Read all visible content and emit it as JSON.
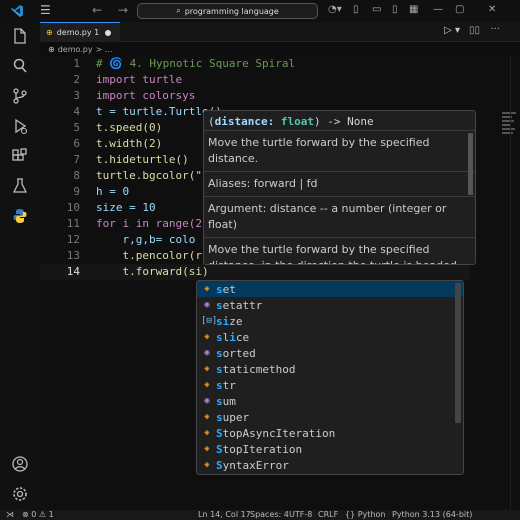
{
  "titlebar": {
    "menu_icon": "hamburger-icon",
    "search_text": "programming language",
    "search_icon": "search-icon"
  },
  "activity": [
    "explorer-icon",
    "search-icon",
    "source-control-icon",
    "run-debug-icon",
    "extensions-icon",
    "testing-icon",
    "python-icon",
    "account-icon",
    "settings-icon"
  ],
  "tab": {
    "label": "demo.py 1"
  },
  "breadcrumb": {
    "file": "demo.py",
    "more": "> ..."
  },
  "editor": {
    "lines": [
      {
        "n": "1",
        "code": "# 🌀 4. Hypnotic Square Spiral"
      },
      {
        "n": "2",
        "code": "import turtle"
      },
      {
        "n": "3",
        "code": "import colorsys"
      },
      {
        "n": "4",
        "code": "t = turtle.Turtle()"
      },
      {
        "n": "5",
        "code": "t.speed(0)"
      },
      {
        "n": "6",
        "code": "t.width(2)"
      },
      {
        "n": "7",
        "code": "t.hideturtle()"
      },
      {
        "n": "8",
        "code": "turtle.bgcolor(\""
      },
      {
        "n": "9",
        "code": "h = 0"
      },
      {
        "n": "10",
        "code": "size = 10"
      },
      {
        "n": "11",
        "code": "for i in range(2"
      },
      {
        "n": "12",
        "code": "    r,g,b= colo"
      },
      {
        "n": "13",
        "code": "    t.pencolor(r"
      },
      {
        "n": "14",
        "code": "    t.forward(si)"
      }
    ]
  },
  "hover": {
    "sig_open": "(",
    "param": "distance",
    "colon": ": ",
    "type": "float",
    "sig_close": ") -> None",
    "desc1": "Move the turtle forward by the specified distance.",
    "aliases": "Aliases: forward | fd",
    "argument": "Argument: distance -- a number (integer or float)",
    "desc2": "Move the turtle forward by the specified distance, in the direction the turtle is headed."
  },
  "suggest": {
    "items": [
      {
        "pre": "s",
        "rest": "et",
        "kind": "class"
      },
      {
        "pre": "s",
        "rest": "etattr",
        "kind": "function"
      },
      {
        "pre": "si",
        "rest": "ze",
        "kind": "variable"
      },
      {
        "pre": "s",
        "rest": "l",
        "rest2": "i",
        "rest3": "ce",
        "kind": "class"
      },
      {
        "pre": "s",
        "rest": "orted",
        "kind": "function"
      },
      {
        "pre": "s",
        "rest": "taticmethod",
        "kind": "class"
      },
      {
        "pre": "s",
        "rest": "tr",
        "kind": "class"
      },
      {
        "pre": "s",
        "rest": "um",
        "kind": "function"
      },
      {
        "pre": "s",
        "rest": "uper",
        "kind": "class"
      },
      {
        "pre": "S",
        "rest": "topAsyncIteration",
        "kind": "class"
      },
      {
        "pre": "S",
        "rest": "topIteration",
        "kind": "class"
      },
      {
        "pre": "S",
        "rest": "yntaxError",
        "kind": "class"
      }
    ]
  },
  "status": {
    "problems": "⊗ 0 ⚠ 1",
    "position": "Ln 14, Col 17",
    "spaces": "Spaces: 4",
    "encoding": "UTF-8",
    "eol": "CRLF",
    "language": "{} Python",
    "interpreter": "Python 3.13 (64-bit)"
  }
}
